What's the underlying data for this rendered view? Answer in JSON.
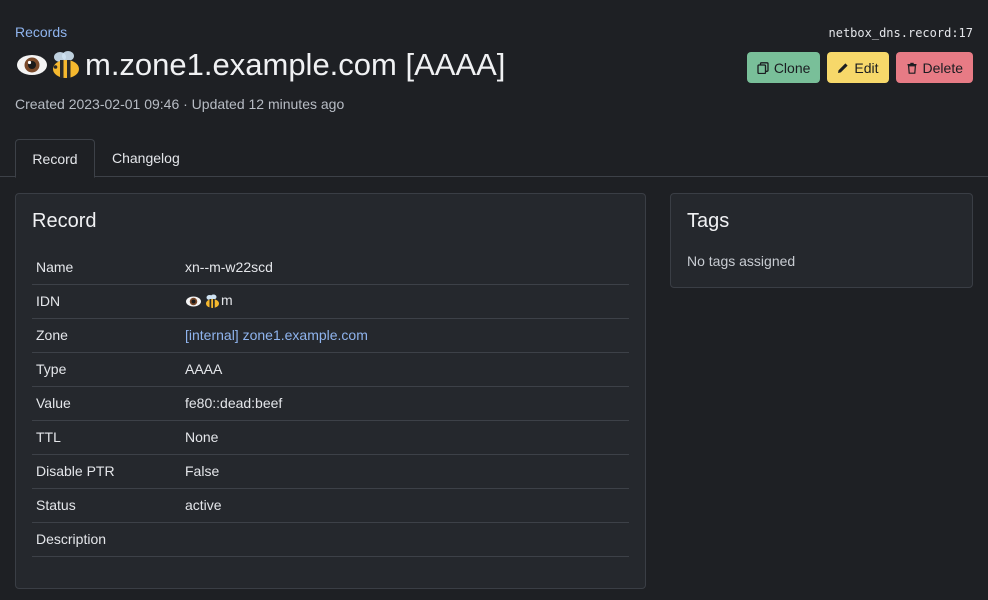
{
  "breadcrumb": {
    "label": "Records"
  },
  "object_id": "netbox_dns.record:17",
  "title": {
    "text": "m.zone1.example.com [AAAA]",
    "emoji": [
      "eye-icon",
      "bee-icon"
    ]
  },
  "subtitle": "Created 2023-02-01 09:46 · Updated 12 minutes ago",
  "actions": {
    "clone": "Clone",
    "edit": "Edit",
    "delete": "Delete"
  },
  "tabs": [
    {
      "label": "Record",
      "active": true
    },
    {
      "label": "Changelog",
      "active": false
    }
  ],
  "record_card": {
    "title": "Record",
    "rows": [
      {
        "label": "Name",
        "value": "xn--m-w22scd"
      },
      {
        "label": "IDN",
        "value": "m",
        "emoji": [
          "eye-icon",
          "bee-icon"
        ]
      },
      {
        "label": "Zone",
        "value": "[internal] zone1.example.com",
        "link": true
      },
      {
        "label": "Type",
        "value": "AAAA"
      },
      {
        "label": "Value",
        "value": "fe80::dead:beef"
      },
      {
        "label": "TTL",
        "value": "None"
      },
      {
        "label": "Disable PTR",
        "value": "False"
      },
      {
        "label": "Status",
        "value": "active"
      },
      {
        "label": "Description",
        "value": ""
      }
    ]
  },
  "tags_card": {
    "title": "Tags",
    "empty_text": "No tags assigned"
  },
  "colors": {
    "background": "#1e2024",
    "card": "#25282d",
    "link": "#8fb4ee",
    "clone": "#79bf99",
    "edit": "#f7d86a",
    "delete": "#e77b85"
  }
}
